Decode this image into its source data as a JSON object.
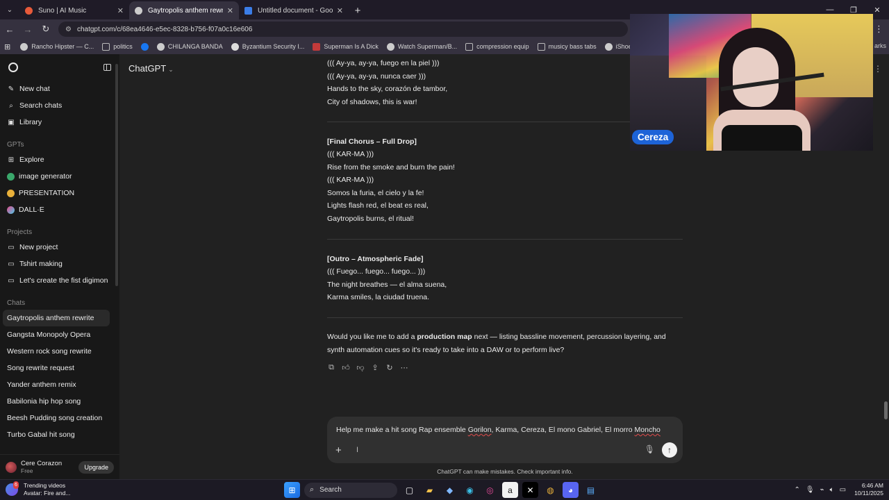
{
  "browser": {
    "tabs": [
      {
        "label": "Suno | AI Music",
        "active": false,
        "color": "#e85a3a"
      },
      {
        "label": "Gaytropolis anthem rewrite",
        "active": true,
        "color": "#cccccc"
      },
      {
        "label": "Untitled document - Google D",
        "active": false,
        "color": "#3b7de8"
      }
    ],
    "url": "chatgpt.com/c/68ea4646-e5ec-8328-b756-f07a0c16e606",
    "bookmarks": [
      {
        "label": "Rancho Hipster — C...",
        "color": "#cccccc"
      },
      {
        "label": "politics",
        "color": "#bbbbbb"
      },
      {
        "label": "",
        "color": "#1877f2"
      },
      {
        "label": "CHILANGA BANDA",
        "color": "#cccccc"
      },
      {
        "label": "Byzantium Security I...",
        "color": "#dddddd"
      },
      {
        "label": "Superman Is A Dick",
        "color": "#c23a3a"
      },
      {
        "label": "Watch Superman/B...",
        "color": "#cccccc"
      },
      {
        "label": "compression equip",
        "color": "#bbbbbb"
      },
      {
        "label": "musicy bass tabs",
        "color": "#bbbbbb"
      },
      {
        "label": "iShoes motorized sk...",
        "color": "#cccccc"
      }
    ],
    "bookmarks_overflow": "arks"
  },
  "sidebar": {
    "top_items": [
      {
        "label": "New chat",
        "icon": "new-chat-icon",
        "glyph": "✎"
      },
      {
        "label": "Search chats",
        "icon": "search-icon",
        "glyph": "⌕"
      },
      {
        "label": "Library",
        "icon": "library-icon",
        "glyph": "▣"
      }
    ],
    "gpts_heading": "GPTs",
    "gpts": [
      {
        "label": "Explore",
        "icon": "explore-icon",
        "glyph": "⊞"
      },
      {
        "label": "image generator",
        "icon": "image-generator-icon",
        "glyph": "●"
      },
      {
        "label": "PRESENTATION",
        "icon": "presentation-icon",
        "glyph": "●"
      },
      {
        "label": "DALL·E",
        "icon": "dalle-icon",
        "glyph": "●"
      }
    ],
    "projects_heading": "Projects",
    "projects": [
      {
        "label": "New project",
        "icon": "folder-plus-icon",
        "glyph": "▭"
      },
      {
        "label": "Tshirt making",
        "icon": "folder-icon",
        "glyph": "▭"
      },
      {
        "label": "Let's create the fist digimon",
        "icon": "folder-icon",
        "glyph": "▭"
      }
    ],
    "chats_heading": "Chats",
    "chats": [
      "Gaytropolis anthem rewrite",
      "Gangsta Monopoly Opera",
      "Western rock song rewrite",
      "Song rewrite request",
      "Yander anthem remix",
      "Babilonia hip hop song",
      "Beesh Pudding song creation",
      "Turbo Gabal hit song"
    ],
    "selected_chat": 0,
    "user": {
      "name": "Cere Corazon",
      "plan": "Free",
      "upgrade_label": "Upgrade"
    }
  },
  "main": {
    "model_label": "ChatGPT",
    "lines_block1": [
      {
        "text": "((( Ay-ya, ay-ya, fuego en la piel )))",
        "bold": false
      },
      {
        "text": "((( Ay-ya, ay-ya, nunca caer )))",
        "bold": false
      },
      {
        "text": "Hands to the sky, corazón de tambor,",
        "bold": false
      },
      {
        "text": "City of shadows, this is war!",
        "bold": false
      }
    ],
    "lines_block2": [
      {
        "text": "[Final Chorus – Full Drop]",
        "bold": true
      },
      {
        "text": "((( KAR-MA )))",
        "bold": false
      },
      {
        "text": "Rise from the smoke and burn the pain!",
        "bold": false
      },
      {
        "text": "((( KAR-MA )))",
        "bold": false
      },
      {
        "text": "Somos la furia, el cielo y la fe!",
        "bold": false
      },
      {
        "text": "Lights flash red, el beat es real,",
        "bold": false
      },
      {
        "text": "Gaytropolis burns, el ritual!",
        "bold": false
      }
    ],
    "lines_block3": [
      {
        "text": "[Outro – Atmospheric Fade]",
        "bold": true
      },
      {
        "text": "((( Fuego... fuego... fuego... )))",
        "bold": false
      },
      {
        "text": "The night breathes — el alma suena,",
        "bold": false
      },
      {
        "text": "Karma smiles, la ciudad truena.",
        "bold": false
      }
    ],
    "followup_pre": "Would you like me to add a ",
    "followup_bold": "production map",
    "followup_post": " next — listing bassline movement, percussion layering, and",
    "followup_line2": "synth automation cues so it's ready to take into a DAW or to perform live?",
    "composer": {
      "text_plain": "Help me make a hit song Rap ensemble ",
      "names": [
        {
          "text": "Gorilon",
          "flag": true
        },
        {
          "text": ", Karma, Cereza, El mono Gabriel, El morro ",
          "flag": false
        },
        {
          "text": "Moncho",
          "flag": true
        }
      ]
    },
    "disclaimer": "ChatGPT can make mistakes. Check important info."
  },
  "webcam": {
    "name_label": "Cereza",
    "label_color": "#1d63d8"
  },
  "taskbar": {
    "weather_title": "Trending videos",
    "weather_sub": "Avatar: Fire and...",
    "badge": "6",
    "search_label": "Search",
    "time": "6:46 AM",
    "date": "10/11/2025"
  }
}
